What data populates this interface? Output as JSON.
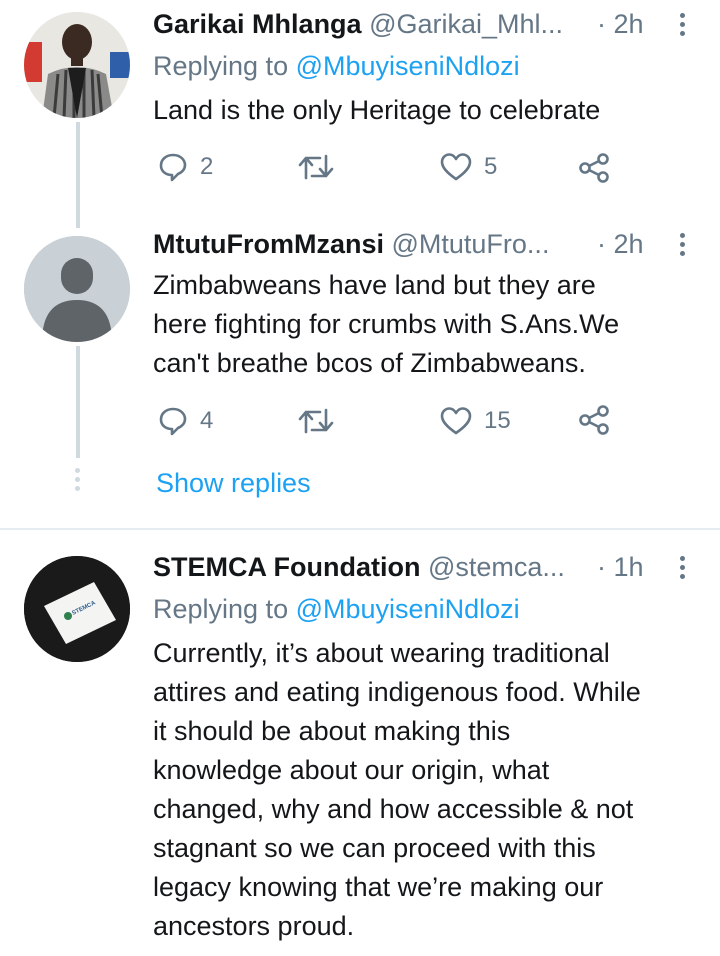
{
  "tweets": [
    {
      "name": "Garikai Mhlanga",
      "handle": "@Garikai_Mhl...",
      "time": "· 2h",
      "replying_label": "Replying to",
      "replying_to": "@MbuyiseniNdlozi",
      "text": "Land is the only Heritage to celebrate",
      "replies": "2",
      "retweets": "",
      "likes": "5"
    },
    {
      "name": "MtutuFromMzansi",
      "handle": "@MtutuFro...",
      "time": "· 2h",
      "text_lines": [
        "Zimbabweans have land but they are",
        "here fighting for crumbs with S.Ans.We",
        "can't breathe bcos of Zimbabweans."
      ],
      "replies": "4",
      "retweets": "",
      "likes": "15",
      "show_replies": "Show replies"
    },
    {
      "name": "STEMCA Foundation",
      "handle": "@stemca...",
      "time": "· 1h",
      "replying_label": "Replying to",
      "replying_to": "@MbuyiseniNdlozi",
      "text_lines": [
        "Currently, it’s about wearing traditional",
        "attires and eating indigenous food. While",
        "it should be about making this",
        "knowledge about our origin, what",
        "changed, why and how accessible & not",
        "stagnant so we can proceed with this",
        "legacy knowing that we’re making our",
        "ancestors proud."
      ],
      "logo_text": "STEMCA"
    }
  ],
  "colors": {
    "accent": "#1da1f2",
    "muted": "#657786",
    "text": "#14171a",
    "line": "#cfd9de"
  },
  "icons": [
    "reply-icon",
    "retweet-icon",
    "like-icon",
    "share-icon",
    "more-icon"
  ]
}
